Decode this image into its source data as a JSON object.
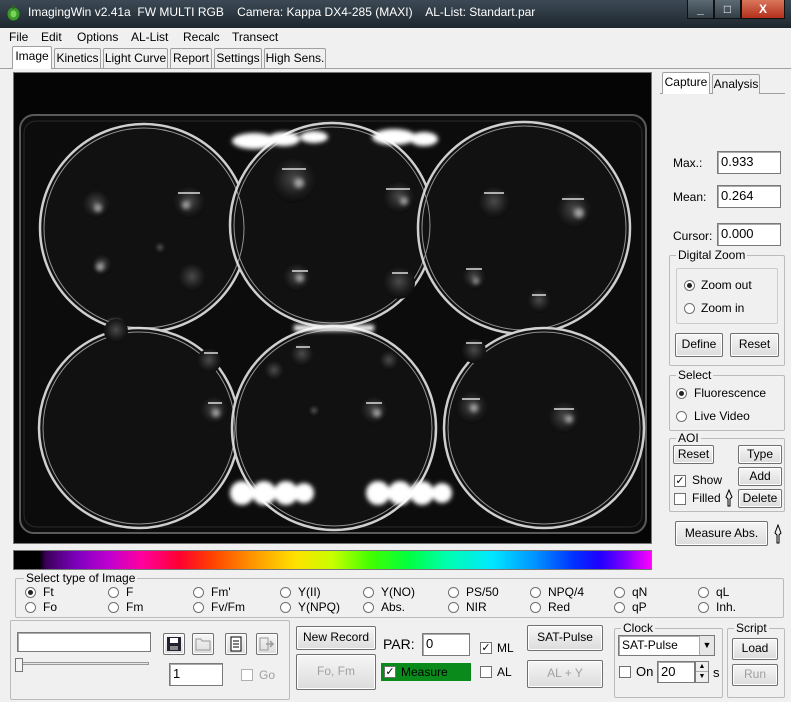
{
  "window": {
    "title": "ImagingWin v2.41a  FW MULTI RGB    Camera: Kappa DX4-285 (MAXI)    AL-List: Standart.par",
    "controls": {
      "minimize": "_",
      "maximize": "□",
      "close": "X"
    }
  },
  "menu": [
    "File",
    "Edit",
    "Options",
    "AL-List",
    "Recalc",
    "Transect"
  ],
  "tabs": [
    "Image",
    "Kinetics",
    "Light Curve",
    "Report",
    "Settings",
    "High Sens."
  ],
  "active_tab": "Image",
  "right_tabs": [
    "Capture",
    "Analysis"
  ],
  "stats": {
    "max_label": "Max.:",
    "max_value": "0.933",
    "mean_label": "Mean:",
    "mean_value": "0.264",
    "cursor_label": "Cursor:",
    "cursor_value": "0.000"
  },
  "digital_zoom": {
    "title": "Digital Zoom",
    "options": [
      "Zoom out",
      "Zoom in"
    ],
    "selected": "Zoom out",
    "define": "Define",
    "reset": "Reset"
  },
  "select": {
    "title": "Select",
    "options": [
      "Fluorescence",
      "Live Video"
    ],
    "selected": "Fluorescence"
  },
  "aoi": {
    "title": "AOI",
    "reset": "Reset",
    "type": "Type",
    "add": "Add",
    "delete": "Delete",
    "show": "Show",
    "show_checked": true,
    "filled": "Filled",
    "filled_checked": false
  },
  "measure_abs": "Measure Abs.",
  "image_type": {
    "title": "Select type of Image",
    "row1": [
      "Ft",
      "F",
      "Fm'",
      "Y(II)",
      "Y(NO)",
      "PS/50",
      "NPQ/4",
      "qN",
      "qL"
    ],
    "row2": [
      "Fo",
      "Fm",
      "Fv/Fm",
      "Y(NPQ)",
      "Abs.",
      "NIR",
      "Red",
      "qP",
      "Inh."
    ],
    "selected": "Ft"
  },
  "record": {
    "frame_value": "1",
    "go": "Go",
    "new_record": "New Record",
    "fo_fm": "Fo, Fm"
  },
  "par": {
    "label": "PAR:",
    "value": "0"
  },
  "ml": {
    "label": "ML",
    "checked": true
  },
  "al": {
    "label": "AL",
    "checked": false
  },
  "measure": {
    "label": "Measure",
    "checked": true
  },
  "sat_pulse": "SAT-Pulse",
  "al_y": "AL + Y",
  "clock": {
    "title": "Clock",
    "mode": "SAT-Pulse",
    "on_label": "On",
    "interval": "20",
    "unit": "s"
  },
  "script": {
    "title": "Script",
    "load": "Load",
    "run": "Run"
  },
  "colors": {
    "title_bar": "#1c262e",
    "measure_green": "#0a8a1a",
    "plate_bg": "#050505"
  }
}
